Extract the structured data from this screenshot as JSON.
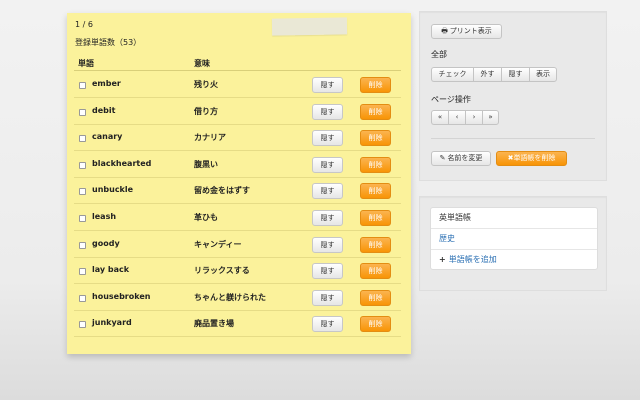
{
  "note": {
    "page_indicator": "1 / 6",
    "word_count_label": "登録単語数（53）",
    "headers": {
      "word": "単語",
      "meaning": "意味"
    },
    "hide_label": "隠す",
    "delete_label": "削除",
    "rows": [
      {
        "word": "ember",
        "meaning": "残り火"
      },
      {
        "word": "debit",
        "meaning": "借り方"
      },
      {
        "word": "canary",
        "meaning": "カナリア"
      },
      {
        "word": "blackhearted",
        "meaning": "腹黒い"
      },
      {
        "word": "unbuckle",
        "meaning": "留め金をはずす"
      },
      {
        "word": "leash",
        "meaning": "革ひも"
      },
      {
        "word": "goody",
        "meaning": "キャンディー"
      },
      {
        "word": "lay back",
        "meaning": "リラックスする"
      },
      {
        "word": "housebroken",
        "meaning": "ちゃんと躾けられた"
      },
      {
        "word": "junkyard",
        "meaning": "廃品置き場"
      }
    ]
  },
  "tools": {
    "print_label": "プリント表示",
    "all_label": "全部",
    "all_buttons": [
      "チェック",
      "外す",
      "隠す",
      "表示"
    ],
    "page_label": "ページ操作",
    "page_buttons": [
      "«",
      "‹",
      "›",
      "»"
    ],
    "rename_label": "名前を変更",
    "delete_book_label": "単語帳を削除"
  },
  "books": {
    "title": "英単語帳",
    "link": "歴史",
    "add_label": "単語帳を追加"
  }
}
